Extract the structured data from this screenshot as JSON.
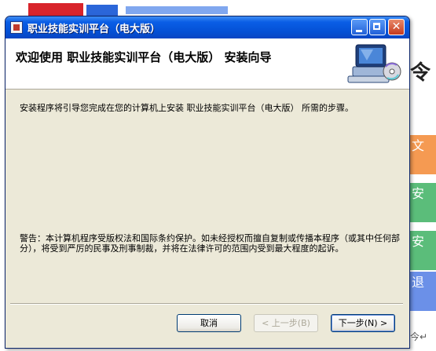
{
  "window": {
    "title": "职业技能实训平台（电大版）"
  },
  "header": {
    "title": "欢迎使用 职业技能实训平台（电大版） 安装向导",
    "graphic_icon": "computer-cd-icon"
  },
  "body": {
    "intro": "安装程序将引导您完成在您的计算机上安装 职业技能实训平台（电大版） 所需的步骤。",
    "warning": "警告：本计算机程序受版权法和国际条约保护。如未经授权而擅自复制或传播本程序（或其中任何部分），将受到严厉的民事及刑事制裁，并将在法律许可的范围内受到最大程度的起诉。"
  },
  "buttons": {
    "cancel": "取消",
    "back": "< 上一步(B)",
    "next": "下一步(N) >"
  },
  "background": {
    "big_char": "令",
    "side_tabs": [
      "文",
      "安",
      "安",
      "退"
    ],
    "mark": "今↵"
  },
  "colors": {
    "titlebar": "#0a5ee6",
    "dialog_bg": "#ece9d8",
    "header_bg": "#ffffff"
  }
}
